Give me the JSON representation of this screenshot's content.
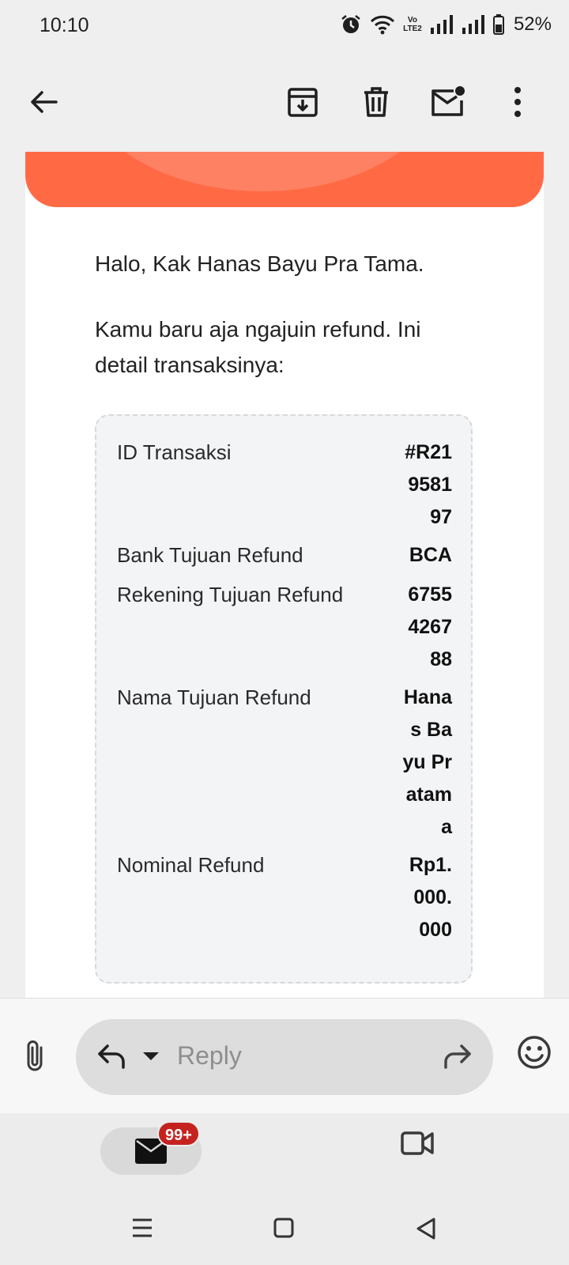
{
  "status_bar": {
    "time": "10:10",
    "network_label": "Vo LTE2",
    "battery": "52%"
  },
  "toolbar": {
    "icons": [
      "back-arrow-icon",
      "archive-icon",
      "trash-icon",
      "mark-unread-icon",
      "more-vert-icon"
    ]
  },
  "email": {
    "greeting": "Halo, Kak Hanas Bayu Pra Tama.",
    "intro": "Kamu baru aja ngajuin refund. Ini detail transaksinya:",
    "banner_color": "#ff6a45",
    "details": [
      {
        "label": "ID Transaksi",
        "value": "#R21958197"
      },
      {
        "label": "Bank Tujuan Refund",
        "value": "BCA"
      },
      {
        "label": "Rekening Tujuan Refund",
        "value": "6755426788"
      },
      {
        "label": "Nama Tujuan Refund",
        "value": "Hanas Bayu Pratama"
      },
      {
        "label": "Nominal Refund",
        "value": "Rp1.000.000"
      }
    ]
  },
  "reply_bar": {
    "placeholder": "Reply"
  },
  "bottom_nav": {
    "mail_badge": "99+",
    "badge_color": "#c5221f"
  }
}
